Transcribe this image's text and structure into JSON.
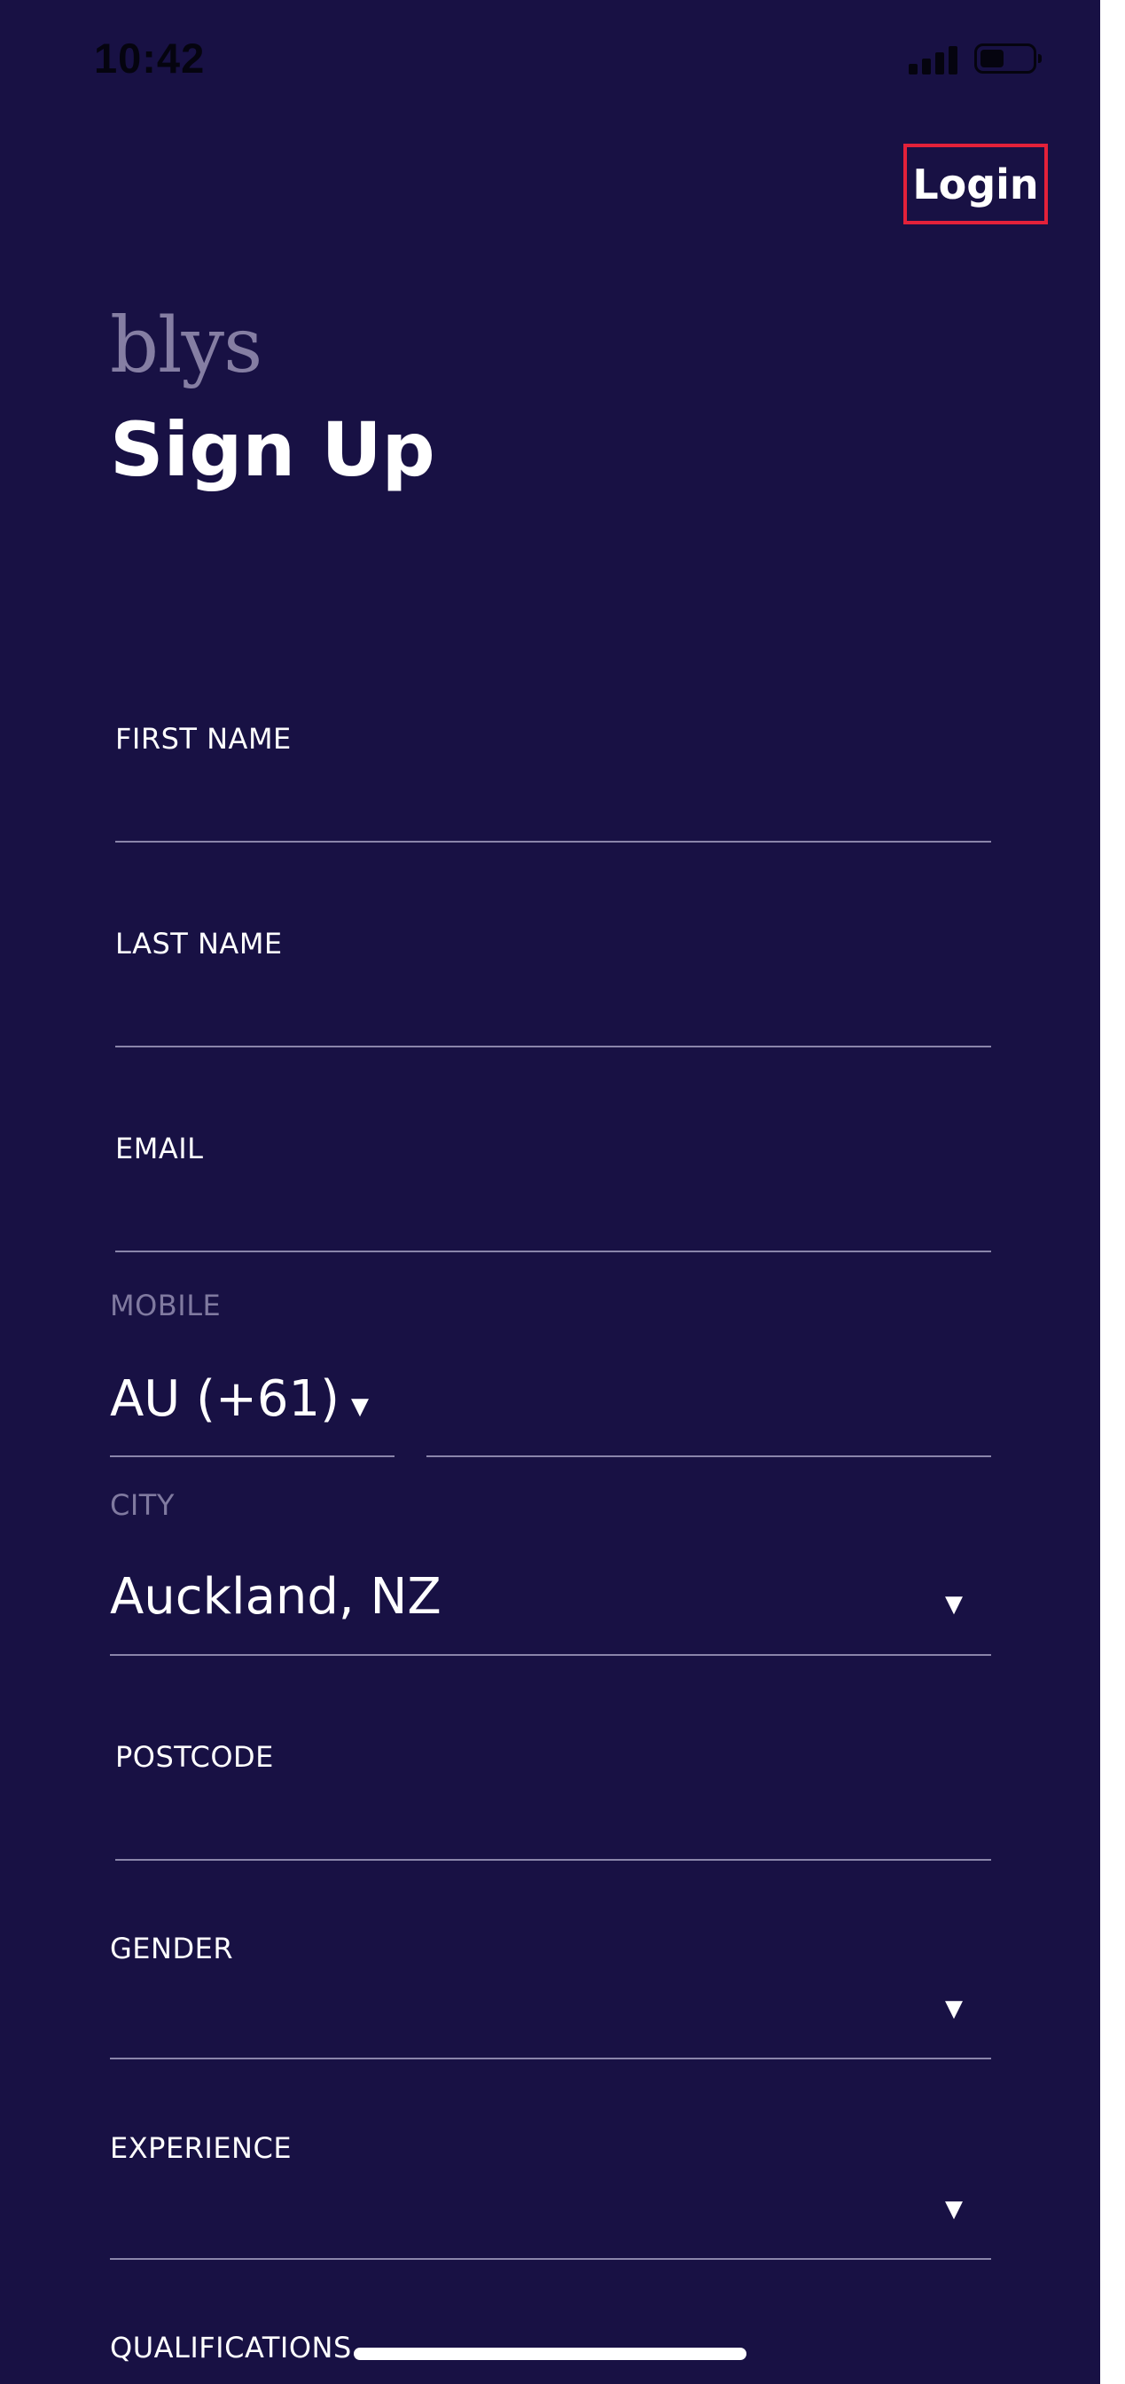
{
  "status_bar": {
    "time": "10:42"
  },
  "header": {
    "login_label": "Login",
    "highlight_color": "#e3213a"
  },
  "brand": {
    "logo_text": "blys"
  },
  "page": {
    "title": "Sign Up",
    "background_color": "#181144"
  },
  "form": {
    "first_name": {
      "label": "FIRST NAME",
      "value": ""
    },
    "last_name": {
      "label": "LAST NAME",
      "value": ""
    },
    "email": {
      "label": "EMAIL",
      "value": ""
    },
    "mobile": {
      "label": "MOBILE",
      "country_code": "AU (+61)",
      "number": ""
    },
    "city": {
      "label": "CITY",
      "value": "Auckland, NZ"
    },
    "postcode": {
      "label": "POSTCODE",
      "value": ""
    },
    "gender": {
      "label": "GENDER",
      "value": ""
    },
    "experience": {
      "label": "EXPERIENCE",
      "value": ""
    },
    "qualifications": {
      "label": "QUALIFICATIONS"
    }
  },
  "icons": {
    "dropdown_caret": "▼"
  }
}
